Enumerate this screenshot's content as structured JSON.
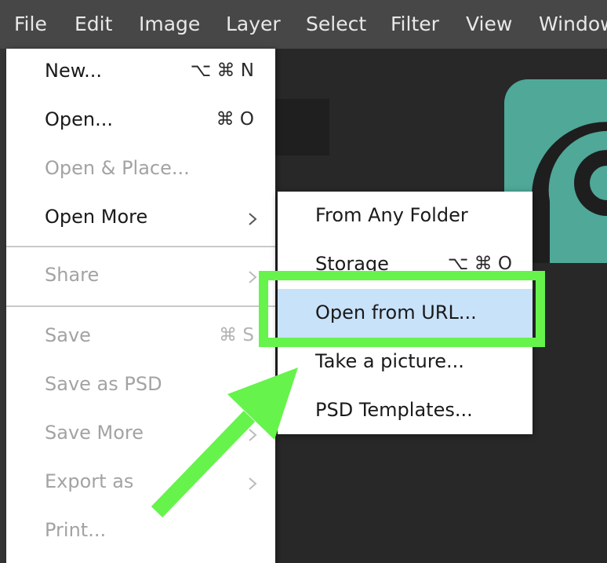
{
  "menubar": {
    "items": [
      "File",
      "Edit",
      "Image",
      "Layer",
      "Select",
      "Filter",
      "View",
      "Window"
    ]
  },
  "file_menu": {
    "items": [
      {
        "label": "New...",
        "shortcut": "⌥ ⌘ N",
        "enabled": true
      },
      {
        "label": "Open...",
        "shortcut": "⌘ O",
        "enabled": true
      },
      {
        "label": "Open & Place...",
        "shortcut": "",
        "enabled": false
      },
      {
        "label": "Open More",
        "shortcut": "",
        "enabled": true,
        "submenu": true
      },
      {
        "label": "Share",
        "shortcut": "",
        "enabled": false,
        "submenu": true
      },
      {
        "label": "Save",
        "shortcut": "⌘ S",
        "enabled": false
      },
      {
        "label": "Save as PSD",
        "shortcut": "",
        "enabled": false
      },
      {
        "label": "Save More",
        "shortcut": "",
        "enabled": false,
        "submenu": true
      },
      {
        "label": "Export as",
        "shortcut": "",
        "enabled": false,
        "submenu": true
      },
      {
        "label": "Print...",
        "shortcut": "",
        "enabled": false
      }
    ]
  },
  "open_more_menu": {
    "items": [
      {
        "label": "From Any Folder",
        "shortcut": ""
      },
      {
        "label": "Storage",
        "shortcut": "⌥ ⌘ O"
      },
      {
        "label": "Open from URL...",
        "shortcut": "",
        "highlighted": true
      },
      {
        "label": "Take a picture...",
        "shortcut": ""
      },
      {
        "label": "PSD Templates...",
        "shortcut": ""
      }
    ]
  },
  "colors": {
    "menubar_bg": "#474747",
    "canvas_bg": "#282828",
    "highlight_row": "#c8e2fa",
    "annotation_green": "#66f34c",
    "logo_teal": "#4fa898"
  },
  "icons": [
    "submenu-arrow-icon",
    "annotation-arrow",
    "app-logo"
  ]
}
